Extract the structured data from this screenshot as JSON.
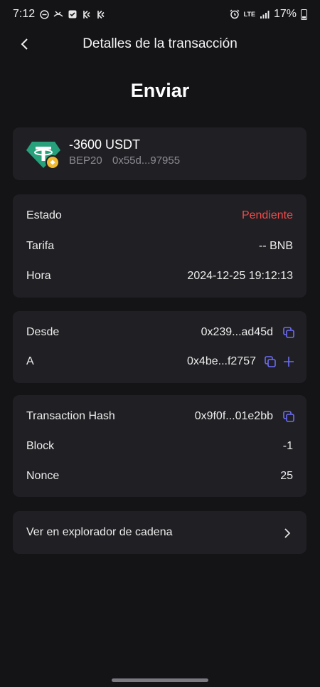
{
  "status_bar": {
    "time": "7:12",
    "network": "LTE",
    "battery": "17%",
    "icons": [
      "do-not-disturb-icon",
      "missed-call-icon",
      "check-box-icon",
      "kucoin-icon",
      "kucoin-icon",
      "alarm-icon",
      "lte-icon",
      "signal-icon",
      "battery-icon"
    ]
  },
  "header": {
    "title": "Detalles de la transacción"
  },
  "page": {
    "heading": "Enviar"
  },
  "asset": {
    "amount": "-3600 USDT",
    "network": "BEP20",
    "address": "0x55d...97955",
    "icon": "usdt-token-icon",
    "badge_icon": "bnb-chain-icon",
    "colors": {
      "token": "#26a17b",
      "badge": "#f3ba2f"
    }
  },
  "details": {
    "status_label": "Estado",
    "status_value": "Pendiente",
    "status_color": "#f04a4a",
    "fee_label": "Tarifa",
    "fee_value": "-- BNB",
    "time_label": "Hora",
    "time_value": "2024-12-25 19:12:13"
  },
  "addresses": {
    "from_label": "Desde",
    "from_value": "0x239...ad45d",
    "to_label": "A",
    "to_value": "0x4be...f2757"
  },
  "chain": {
    "hash_label": "Transaction Hash",
    "hash_value": "0x9f0f...01e2bb",
    "block_label": "Block",
    "block_value": "-1",
    "nonce_label": "Nonce",
    "nonce_value": "25"
  },
  "explorer": {
    "label": "Ver en explorador de cadena"
  },
  "accent_color": "#6c6cf5"
}
